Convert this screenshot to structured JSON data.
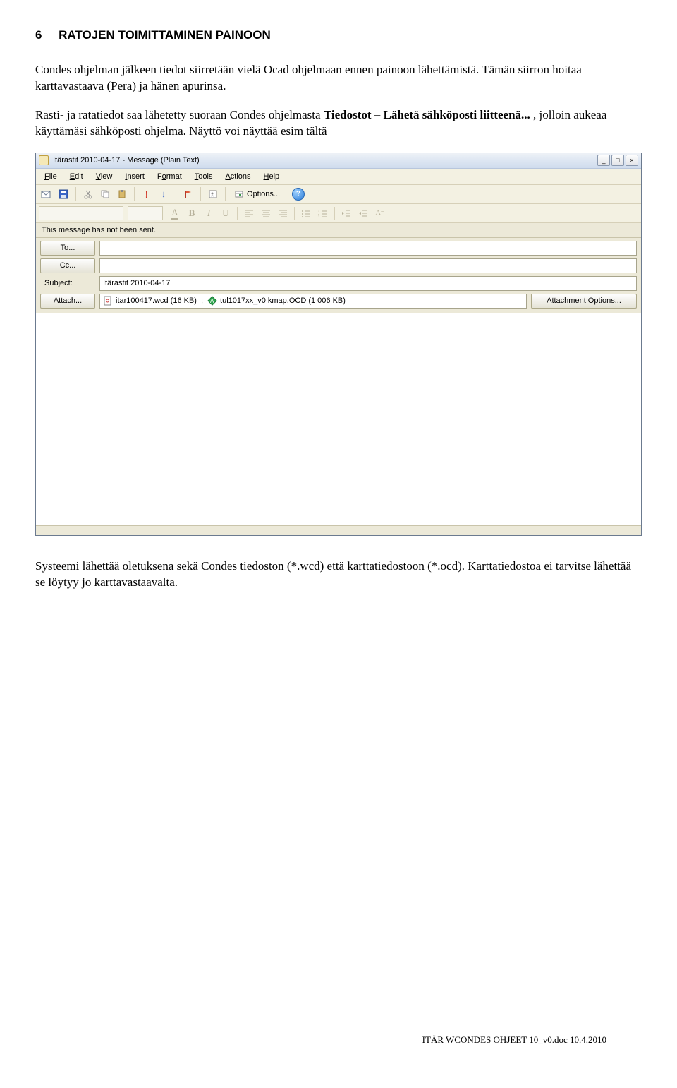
{
  "heading_num": "6",
  "heading_text": "RATOJEN TOIMITTAMINEN PAINOON",
  "para1": "Condes ohjelman jälkeen tiedot siirretään vielä Ocad ohjelmaan ennen painoon lähettämistä. Tämän siirron hoitaa karttavastaava (Pera) ja hänen apurinsa.",
  "para2a": "Rasti- ja ratatiedot saa lähetetty suoraan Condes ohjelmasta ",
  "para2b_bold": "Tiedostot – Lähetä sähköposti liitteenä...",
  "para2c": " , jolloin aukeaa käyttämäsi sähköposti ohjelma. Näyttö voi näyttää esim tältä",
  "window": {
    "title": "Itärastit 2010-04-17 - Message (Plain Text)",
    "min": "_",
    "max": "□",
    "close": "×",
    "menu": {
      "file": "File",
      "edit": "Edit",
      "view": "View",
      "insert": "Insert",
      "format": "Format",
      "tools": "Tools",
      "actions": "Actions",
      "help": "Help"
    },
    "options_label": "Options...",
    "info": "This message has not been sent.",
    "to_label": "To...",
    "cc_label": "Cc...",
    "subject_label": "Subject:",
    "subject_value": "Itärastit 2010-04-17",
    "attach_label": "Attach...",
    "attachment1": "itar100417.wcd (16 KB)",
    "attachment2": "tul1017xx_v0 kmap.OCD (1 006 KB)",
    "attach_options": "Attachment Options...",
    "fmt_A": "A",
    "fmt_B": "B",
    "fmt_I": "I",
    "fmt_U": "U"
  },
  "after_para": "Systeemi lähettää oletuksena sekä Condes tiedoston (*.wcd) että karttatiedostoon (*.ocd). Karttatiedostoa ei tarvitse lähettää se löytyy jo karttavastaavalta.",
  "footer": "ITÄR WCONDES OHJEET 10_v0.doc   10.4.2010"
}
